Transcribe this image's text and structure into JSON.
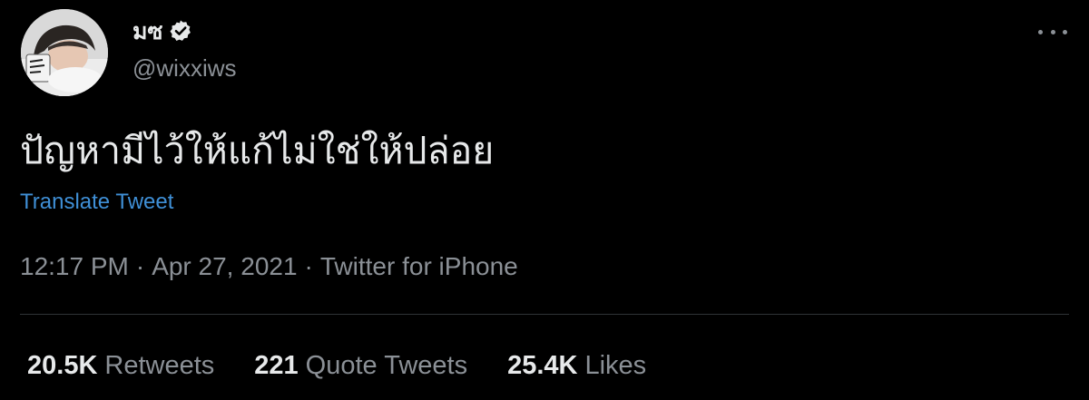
{
  "tweet": {
    "author": {
      "display_name": "มซ",
      "handle": "@wixxiws",
      "verified": true,
      "avatar_icon": "avatar-photo"
    },
    "more_icon": "more-horizontal-icon",
    "text": "ปัญหามีไว้ให้แก้ไม่ใช่ให้ปล่อย",
    "translate_label": "Translate Tweet",
    "time": "12:17 PM",
    "date": "Apr 27, 2021",
    "separator": "·",
    "source": "Twitter for iPhone",
    "stats": {
      "retweets": {
        "count": "20.5K",
        "label": "Retweets"
      },
      "quote_tweets": {
        "count": "221",
        "label": "Quote Tweets"
      },
      "likes": {
        "count": "25.4K",
        "label": "Likes"
      }
    }
  },
  "colors": {
    "background": "#000000",
    "text_primary": "#e7e9ea",
    "text_secondary": "#8b9096",
    "link": "#3f8fd6",
    "divider": "#2f3336"
  }
}
